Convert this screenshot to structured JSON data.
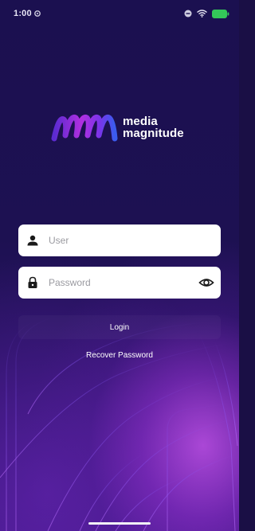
{
  "status_bar": {
    "time": "1:00"
  },
  "brand": {
    "line1": "media",
    "line2": "magnitude",
    "gradient_start": "#6f2bd9",
    "gradient_mid": "#b12fe0",
    "gradient_end": "#3a5cf0"
  },
  "form": {
    "user_placeholder": "User",
    "user_value": "",
    "password_placeholder": "Password",
    "password_value": "",
    "user_icon": "person-icon",
    "password_icon": "lock-icon",
    "visibility_icon": "eye-icon"
  },
  "actions": {
    "login_label": "Login",
    "recover_label": "Recover Password"
  },
  "colors": {
    "background": "#1b1050",
    "glow": "#be50e6",
    "field_background": "#ffffff",
    "battery": "#34c759"
  }
}
